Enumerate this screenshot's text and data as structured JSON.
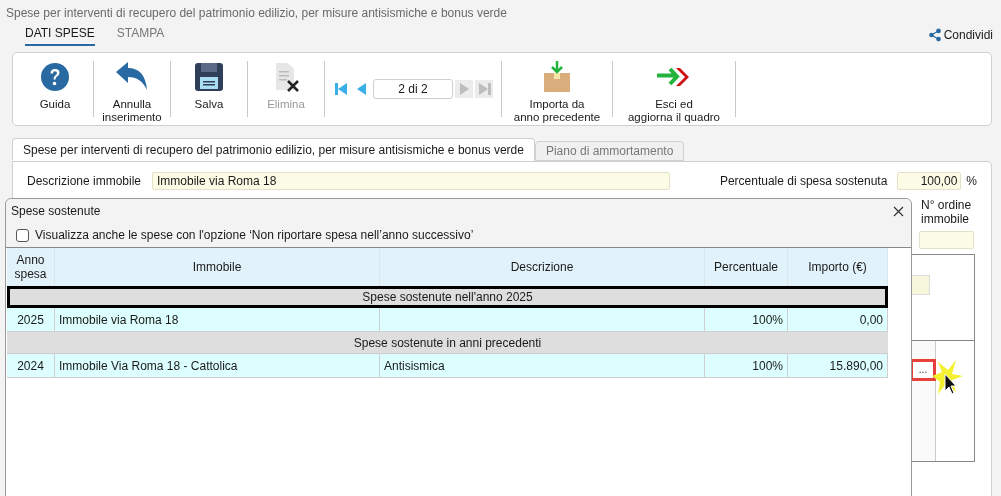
{
  "window": {
    "title": "Spese per interventi di recupero del patrimonio edilizio, per misure antisismiche e bonus verde"
  },
  "ribbon_tabs": [
    {
      "label": "DATI SPESE",
      "selected": true
    },
    {
      "label": "STAMPA",
      "selected": false
    }
  ],
  "share": {
    "label": "Condividi"
  },
  "toolbar": [
    {
      "kind": "help",
      "lines": [
        "Guida"
      ],
      "disabled": false
    },
    {
      "kind": "undo",
      "lines": [
        "Annulla",
        "inserimento"
      ],
      "disabled": false
    },
    {
      "kind": "save",
      "lines": [
        "Salva"
      ],
      "disabled": false
    },
    {
      "kind": "delete",
      "lines": [
        "Elimina"
      ],
      "disabled": true
    },
    {
      "kind": "navigator",
      "value": "2 di 2",
      "buttons": [
        {
          "kind": "first",
          "disabled": false
        },
        {
          "kind": "prev",
          "disabled": false
        },
        {
          "kind": "next",
          "disabled": true
        },
        {
          "kind": "last",
          "disabled": true
        }
      ]
    },
    {
      "kind": "import",
      "lines": [
        "Importa da",
        "anno precedente"
      ],
      "disabled": false
    },
    {
      "kind": "exit",
      "lines": [
        "Esci ed",
        "aggiorna il quadro"
      ],
      "disabled": false
    }
  ],
  "form_tabs": [
    {
      "label": "Spese per interventi di recupero del patrimonio edilizio, per misure antisismiche e bonus verde",
      "selected": true
    },
    {
      "label": "Piano di ammortamento",
      "selected": false
    }
  ],
  "form": {
    "description_label": "Descrizione immobile",
    "description_value": "Immobile via Roma 18",
    "percent_label": "Percentuale di spesa sostenuta",
    "percent_value": "100,00",
    "percent_unit": "%",
    "order_label": [
      "N° ordine",
      "immobile"
    ],
    "more_button": {
      "label": "...",
      "highlighted": true
    }
  },
  "dialog": {
    "title": "Spese sostenute",
    "checkbox": {
      "label": "Visualizza anche le spese con l'opzione ‘Non riportare spesa nell’anno successivo’",
      "checked": false
    },
    "columns": [
      [
        "Anno",
        "spesa"
      ],
      [
        "Immobile"
      ],
      [
        "Descrizione"
      ],
      [
        "Percentuale"
      ],
      [
        "Importo (€)"
      ]
    ],
    "groups": [
      {
        "title": "Spese sostenute nell'anno 2025",
        "selected": true,
        "rows": [
          [
            "2025",
            "Immobile via Roma 18",
            "",
            "100%",
            "0,00"
          ]
        ]
      },
      {
        "title": "Spese sostenute in anni precedenti",
        "selected": false,
        "rows": [
          [
            "2024",
            "Immobile Via Roma 18 - Cattolica",
            "Antisismica",
            "100%",
            "15.890,00"
          ]
        ]
      }
    ]
  }
}
